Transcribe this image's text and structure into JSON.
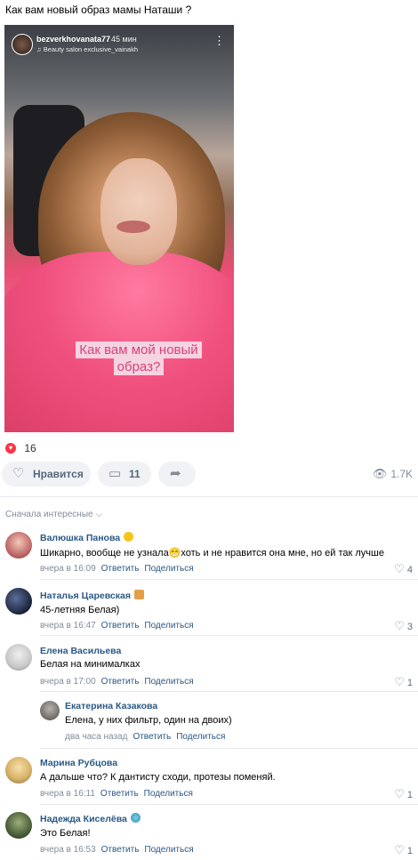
{
  "post": {
    "title": "Как вам новый образ мамы Наташи ?",
    "story": {
      "username": "bezverkhovanata77",
      "time": "45 мин",
      "music": "♫ Beauty salon exclusive_vainakh",
      "more": "⋮",
      "caption_line1": "Как вам мой новый",
      "caption_line2": "образ?"
    },
    "likes_count": "16",
    "actions": {
      "like_label": "Нравится",
      "comments_count": "11",
      "views": "1.7K"
    },
    "sort_label": "Сначала интересные ⌵"
  },
  "comments": [
    {
      "name": "Валюшка Панова",
      "text": "Шикарно, вообще не узнала😁хоть и не нравится она мне, но ей так лучше",
      "time": "вчера в 16:09",
      "reply": "Ответить",
      "share": "Поделиться",
      "likes": "4"
    },
    {
      "name": "Наталья Царевская",
      "text": "45-летняя Белая)",
      "time": "вчера в 16:47",
      "reply": "Ответить",
      "share": "Поделиться",
      "likes": "3"
    },
    {
      "name": "Елена Васильева",
      "text": "Белая на минималках",
      "time": "вчера в 17:00",
      "reply": "Ответить",
      "share": "Поделиться",
      "likes": "1"
    },
    {
      "name": "Екатерина Казакова",
      "text": "Елена, у них фильтр, один на двоих)",
      "time": "два часа назад",
      "reply": "Ответить",
      "share": "Поделиться",
      "likes": ""
    },
    {
      "name": "Марина Рубцова",
      "text": "А дальше что? К дантисту сходи, протезы поменяй.",
      "time": "вчера в 16:11",
      "reply": "Ответить",
      "share": "Поделиться",
      "likes": "1"
    },
    {
      "name": "Надежда Киселёва",
      "text": "Это Белая!",
      "time": "вчера в 16:53",
      "reply": "Ответить",
      "share": "Поделиться",
      "likes": "1"
    }
  ],
  "colors": {
    "link": "#2a5885",
    "accent_red": "#ff3347",
    "muted": "#818c99"
  }
}
